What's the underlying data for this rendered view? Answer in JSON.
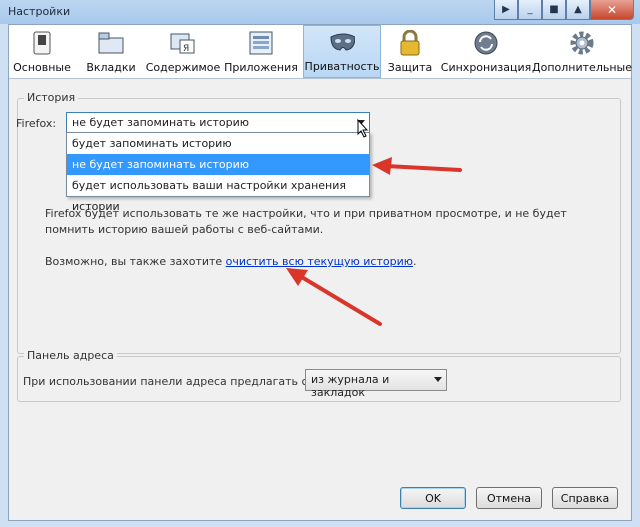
{
  "window": {
    "title": "Настройки"
  },
  "toolbar": {
    "panes": [
      {
        "label": "Основные"
      },
      {
        "label": "Вкладки"
      },
      {
        "label": "Содержимое"
      },
      {
        "label": "Приложения"
      },
      {
        "label": "Приватность"
      },
      {
        "label": "Защита"
      },
      {
        "label": "Синхронизация"
      },
      {
        "label": "Дополнительные"
      }
    ],
    "selected": "Приватность"
  },
  "history": {
    "group_title": "История",
    "firefox_label": "Firefox:",
    "combo_value": "не будет запоминать историю",
    "options": [
      "будет запоминать историю",
      "не будет запоминать историю",
      "будет использовать ваши настройки хранения истории"
    ],
    "description": "Firefox будет использовать те же настройки, что и при приватном просмотре, и не будет помнить историю вашей работы с веб-сайтами.",
    "maybe_text": "Возможно, вы также захотите ",
    "clear_link": "очистить всю текущую историю",
    "maybe_end": "."
  },
  "address_bar": {
    "group_title": "Панель адреса",
    "label": "При использовании панели адреса предлагать ссылки:",
    "combo_value": "из журнала и закладок"
  },
  "buttons": {
    "ok": "OK",
    "cancel": "Отмена",
    "help": "Справка"
  },
  "colors": {
    "selection": "#3399ff",
    "annotation_arrow": "#d9352b",
    "link": "#0033cc"
  }
}
